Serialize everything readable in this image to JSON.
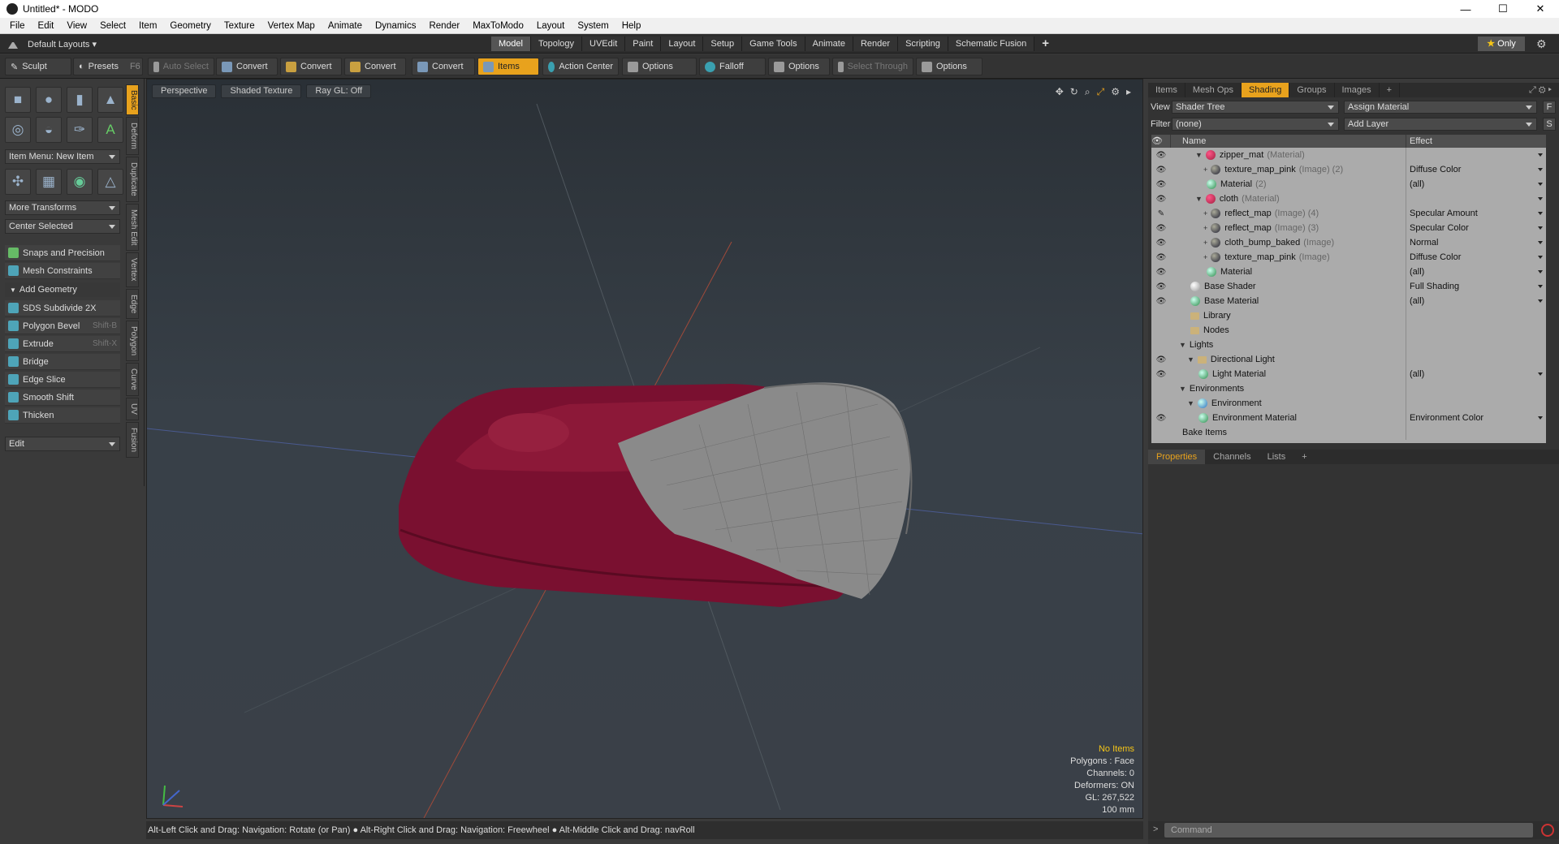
{
  "window": {
    "title": "Untitled* - MODO",
    "minimize": "—",
    "maximize": "☐",
    "close": "✕"
  },
  "menu": [
    "File",
    "Edit",
    "View",
    "Select",
    "Item",
    "Geometry",
    "Texture",
    "Vertex Map",
    "Animate",
    "Dynamics",
    "Render",
    "MaxToModo",
    "Layout",
    "System",
    "Help"
  ],
  "layouts_label": "Default Layouts ▾",
  "mode_tabs": [
    "Model",
    "Topology",
    "UVEdit",
    "Paint",
    "Layout",
    "Setup",
    "Game Tools",
    "Animate",
    "Render",
    "Scripting",
    "Schematic Fusion"
  ],
  "mode_tabs_active": "Model",
  "only_label": "Only",
  "toolbar": {
    "sculpt": "Sculpt",
    "presets": "Presets",
    "presets_key": "F6",
    "auto_select": "Auto Select",
    "convert1": "Convert",
    "convert2": "Convert",
    "convert3": "Convert",
    "convert4": "Convert",
    "items": "Items",
    "action_center": "Action Center",
    "options1": "Options",
    "falloff": "Falloff",
    "options2": "Options",
    "select_through": "Select Through",
    "options3": "Options"
  },
  "left": {
    "vtabs": [
      "Basic",
      "Deform",
      "Duplicate",
      "Mesh Edit",
      "Vertex",
      "Edge",
      "Polygon",
      "Curve",
      "UV",
      "Fusion"
    ],
    "item_menu": "Item Menu: New Item",
    "more_transforms": "More Transforms",
    "center_selected": "Center Selected",
    "snaps": "Snaps and Precision",
    "mesh_constraints": "Mesh Constraints",
    "add_geometry": "Add Geometry",
    "tools": [
      {
        "label": "SDS Subdivide 2X",
        "key": ""
      },
      {
        "label": "Polygon Bevel",
        "key": "Shift-B"
      },
      {
        "label": "Extrude",
        "key": "Shift-X"
      },
      {
        "label": "Bridge",
        "key": ""
      },
      {
        "label": "Edge Slice",
        "key": ""
      },
      {
        "label": "Smooth Shift",
        "key": ""
      },
      {
        "label": "Thicken",
        "key": ""
      }
    ],
    "edit": "Edit"
  },
  "viewport": {
    "perspective": "Perspective",
    "shading": "Shaded Texture",
    "raygl": "Ray GL: Off",
    "info": {
      "items": "No Items",
      "polygons": "Polygons : Face",
      "channels": "Channels: 0",
      "deformers": "Deformers: ON",
      "gl": "GL: 267,522",
      "scale": "100 mm"
    },
    "colors": {
      "cloth": "#7a1030",
      "lining": "#8a8a8a"
    }
  },
  "status": "Alt-Left Click and Drag: Navigation: Rotate (or Pan) ● Alt-Right Click and Drag: Navigation: Freewheel ● Alt-Middle Click and Drag: navRoll",
  "right": {
    "tabs": [
      "Items",
      "Mesh Ops",
      "Shading",
      "Groups",
      "Images"
    ],
    "active_tab": "Shading",
    "view_label": "View",
    "view_value": "Shader Tree",
    "assign_material": "Assign Material",
    "filter_label": "Filter",
    "filter_value": "(none)",
    "add_layer": "Add Layer",
    "col_name": "Name",
    "col_effect": "Effect",
    "tree": [
      {
        "indent": 3,
        "tw": "▼",
        "icon": "red",
        "name": "zipper_mat",
        "tag": "(Material)",
        "effect": "",
        "eye": "👁",
        "arrow": true
      },
      {
        "indent": 4,
        "tw": "+",
        "icon": "dark",
        "name": "texture_map_pink",
        "tag": "(Image) (2)",
        "effect": "Diffuse Color",
        "eye": "👁",
        "arrow": true
      },
      {
        "indent": 4,
        "tw": "",
        "icon": "green",
        "name": "Material",
        "tag": "(2)",
        "effect": "(all)",
        "eye": "👁",
        "arrow": true
      },
      {
        "indent": 3,
        "tw": "▼",
        "icon": "red",
        "name": "cloth",
        "tag": "(Material)",
        "effect": "",
        "eye": "👁",
        "arrow": true
      },
      {
        "indent": 4,
        "tw": "+",
        "icon": "dark",
        "name": "reflect_map",
        "tag": "(Image) (4)",
        "effect": "Specular Amount",
        "eye": "✎",
        "arrow": true
      },
      {
        "indent": 4,
        "tw": "+",
        "icon": "dark",
        "name": "reflect_map",
        "tag": "(Image) (3)",
        "effect": "Specular Color",
        "eye": "👁",
        "arrow": true
      },
      {
        "indent": 4,
        "tw": "+",
        "icon": "dark",
        "name": "cloth_bump_baked",
        "tag": "(Image)",
        "effect": "Normal",
        "eye": "👁",
        "arrow": true
      },
      {
        "indent": 4,
        "tw": "+",
        "icon": "dark",
        "name": "texture_map_pink",
        "tag": "(Image)",
        "effect": "Diffuse Color",
        "eye": "👁",
        "arrow": true
      },
      {
        "indent": 4,
        "tw": "",
        "icon": "green",
        "name": "Material",
        "tag": "",
        "effect": "(all)",
        "eye": "👁",
        "arrow": true
      },
      {
        "indent": 2,
        "tw": "",
        "icon": "grey",
        "name": "Base Shader",
        "tag": "",
        "effect": "Full Shading",
        "eye": "👁",
        "arrow": true
      },
      {
        "indent": 2,
        "tw": "",
        "icon": "green",
        "name": "Base Material",
        "tag": "",
        "effect": "(all)",
        "eye": "👁",
        "arrow": true
      },
      {
        "indent": 2,
        "tw": "",
        "icon": "folder",
        "name": "Library",
        "tag": "",
        "effect": "",
        "eye": "",
        "arrow": false
      },
      {
        "indent": 2,
        "tw": "",
        "icon": "folder",
        "name": "Nodes",
        "tag": "",
        "effect": "",
        "eye": "",
        "arrow": false
      },
      {
        "indent": 1,
        "tw": "▼",
        "icon": "",
        "name": "Lights",
        "tag": "",
        "effect": "",
        "eye": "",
        "arrow": false
      },
      {
        "indent": 2,
        "tw": "▼",
        "icon": "folder",
        "name": "Directional Light",
        "tag": "",
        "effect": "",
        "eye": "👁",
        "arrow": false
      },
      {
        "indent": 3,
        "tw": "",
        "icon": "green",
        "name": "Light Material",
        "tag": "",
        "effect": "(all)",
        "eye": "👁",
        "arrow": true
      },
      {
        "indent": 1,
        "tw": "▼",
        "icon": "",
        "name": "Environments",
        "tag": "",
        "effect": "",
        "eye": "",
        "arrow": false
      },
      {
        "indent": 2,
        "tw": "▼",
        "icon": "blue",
        "name": "Environment",
        "tag": "",
        "effect": "",
        "eye": "",
        "arrow": false
      },
      {
        "indent": 3,
        "tw": "",
        "icon": "green",
        "name": "Environment Material",
        "tag": "",
        "effect": "Environment Color",
        "eye": "👁",
        "arrow": true
      },
      {
        "indent": 1,
        "tw": "",
        "icon": "",
        "name": "Bake Items",
        "tag": "",
        "effect": "",
        "eye": "",
        "arrow": false
      }
    ],
    "bottom_tabs": [
      "Properties",
      "Channels",
      "Lists"
    ],
    "bottom_active": "Properties"
  },
  "command_placeholder": "Command"
}
